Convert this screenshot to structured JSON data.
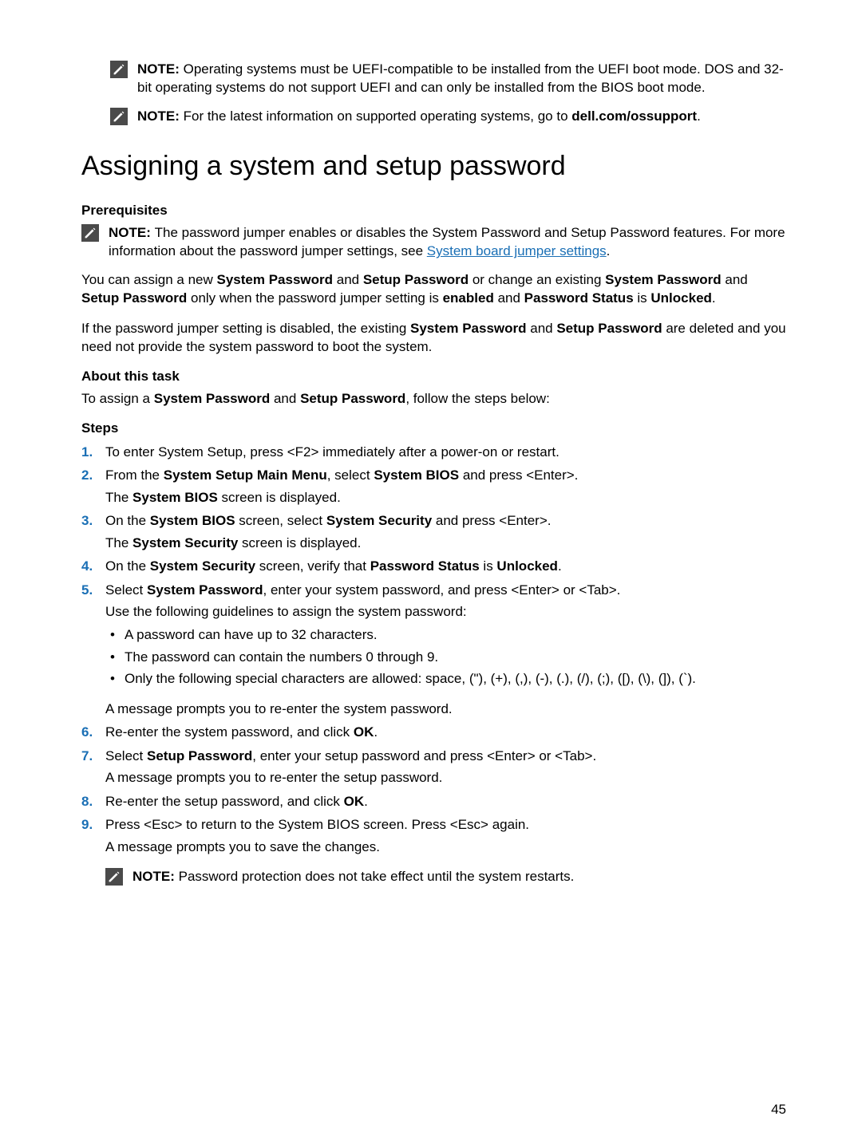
{
  "notes": {
    "n1_label": "NOTE: ",
    "n1_text": "Operating systems must be UEFI-compatible to be installed from the UEFI boot mode. DOS and 32-bit operating systems do not support UEFI and can only be installed from the BIOS boot mode.",
    "n2_label": "NOTE: ",
    "n2_text_a": "For the latest information on supported operating systems, go to ",
    "n2_text_b": "dell.com/ossupport",
    "n2_text_c": ".",
    "n3_label": "NOTE: ",
    "n3_text_a": "The password jumper enables or disables the System Password and Setup Password features. For more information about the password jumper settings, see ",
    "n3_link": "System board jumper settings",
    "n3_text_b": ".",
    "n4_label": "NOTE: ",
    "n4_text": "Password protection does not take effect until the system restarts."
  },
  "title": "Assigning a system and setup password",
  "prereq_head": "Prerequisites",
  "para1_a": "You can assign a new ",
  "para1_b": "System Password",
  "para1_c": " and ",
  "para1_d": "Setup Password",
  "para1_e": " or change an existing ",
  "para1_f": "System Password",
  "para1_g": " and ",
  "para1_h": "Setup Password",
  "para1_i": " only when the password jumper setting is ",
  "para1_j": "enabled",
  "para1_k": " and ",
  "para1_l": "Password Status",
  "para1_m": " is ",
  "para1_n": "Unlocked",
  "para1_o": ".",
  "para2_a": "If the password jumper setting is disabled, the existing ",
  "para2_b": "System Password",
  "para2_c": " and ",
  "para2_d": "Setup Password",
  "para2_e": " are deleted and you need not provide the system password to boot the system.",
  "about_head": "About this task",
  "about_a": "To assign a ",
  "about_b": "System Password",
  "about_c": " and ",
  "about_d": "Setup Password",
  "about_e": ", follow the steps below:",
  "steps_head": "Steps",
  "s1_num": "1.",
  "s1": "To enter System Setup, press <F2> immediately after a power-on or restart.",
  "s2_num": "2.",
  "s2_a": "From the ",
  "s2_b": "System Setup Main Menu",
  "s2_c": ", select ",
  "s2_d": "System BIOS",
  "s2_e": " and press <Enter>.",
  "s2_f": "The ",
  "s2_g": "System BIOS",
  "s2_h": " screen is displayed.",
  "s3_num": "3.",
  "s3_a": "On the ",
  "s3_b": "System BIOS",
  "s3_c": " screen, select ",
  "s3_d": "System Security",
  "s3_e": " and press <Enter>.",
  "s3_f": "The ",
  "s3_g": "System Security",
  "s3_h": " screen is displayed.",
  "s4_num": "4.",
  "s4_a": "On the ",
  "s4_b": "System Security",
  "s4_c": " screen, verify that ",
  "s4_d": "Password Status",
  "s4_e": " is ",
  "s4_f": "Unlocked",
  "s4_g": ".",
  "s5_num": "5.",
  "s5_a": "Select ",
  "s5_b": "System Password",
  "s5_c": ", enter your system password, and press <Enter> or <Tab>.",
  "s5_d": "Use the following guidelines to assign the system password:",
  "s5_bul1": "A password can have up to 32 characters.",
  "s5_bul2": "The password can contain the numbers 0 through 9.",
  "s5_bul3": "Only the following special characters are allowed: space, (\"), (+), (,), (-), (.), (/), (;), ([), (\\), (]), (`).",
  "s5_msg": "A message prompts you to re-enter the system password.",
  "s6_num": "6.",
  "s6_a": "Re-enter the system password, and click ",
  "s6_b": "OK",
  "s6_c": ".",
  "s7_num": "7.",
  "s7_a": "Select ",
  "s7_b": "Setup Password",
  "s7_c": ", enter your setup password and press <Enter> or <Tab>.",
  "s7_d": "A message prompts you to re-enter the setup password.",
  "s8_num": "8.",
  "s8_a": "Re-enter the setup password, and click ",
  "s8_b": "OK",
  "s8_c": ".",
  "s9_num": "9.",
  "s9_a": "Press <Esc> to return to the System BIOS screen. Press <Esc> again.",
  "s9_b": "A message prompts you to save the changes.",
  "page_num": "45"
}
